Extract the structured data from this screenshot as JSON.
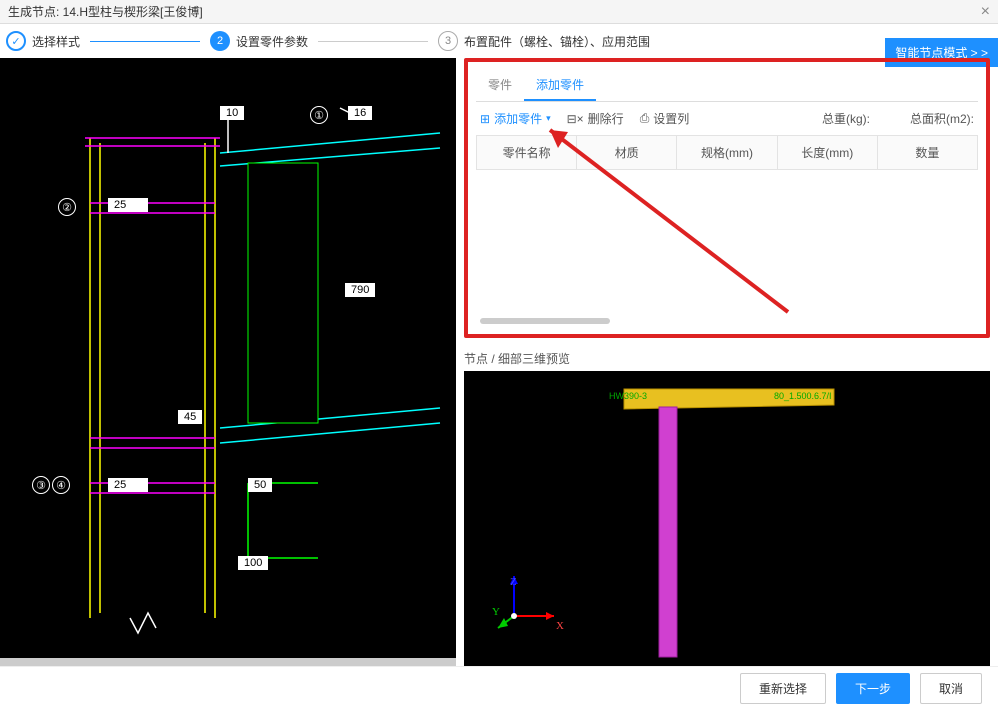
{
  "title": "生成节点: 14.H型柱与楔形梁[王俊博]",
  "stepper": {
    "s1": {
      "num": "✓",
      "label": "选择样式"
    },
    "s2": {
      "num": "2",
      "label": "设置零件参数"
    },
    "s3": {
      "num": "3",
      "label": "布置配件（螺栓、锚栓）、应用范围"
    }
  },
  "smart_mode": "智能节点模式 > >",
  "cad": {
    "marker1": "①",
    "marker2": "②",
    "marker3": "③",
    "marker4": "④",
    "dim10": "10",
    "dim16": "16",
    "dim25a": "25",
    "dim25b": "25",
    "dim790": "790",
    "dim45": "45",
    "dim50": "50",
    "dim100": "100"
  },
  "right": {
    "tab1": "零件",
    "tab2": "添加零件",
    "add_part": "添加零件",
    "delete_row": "删除行",
    "set_col": "设置列",
    "total_weight": "总重(kg):",
    "total_area": "总面积(m2):",
    "cols": {
      "c1": "零件名称",
      "c2": "材质",
      "c3": "规格(mm)",
      "c4": "长度(mm)",
      "c5": "数量"
    }
  },
  "preview": {
    "label": "节点 / 细部三维预览",
    "text_l": "HW390-3",
    "text_r": "80_1.500.6.7/I",
    "z": "Z",
    "y": "Y",
    "x": "X"
  },
  "footer": {
    "reselect": "重新选择",
    "next": "下一步",
    "cancel": "取消"
  }
}
